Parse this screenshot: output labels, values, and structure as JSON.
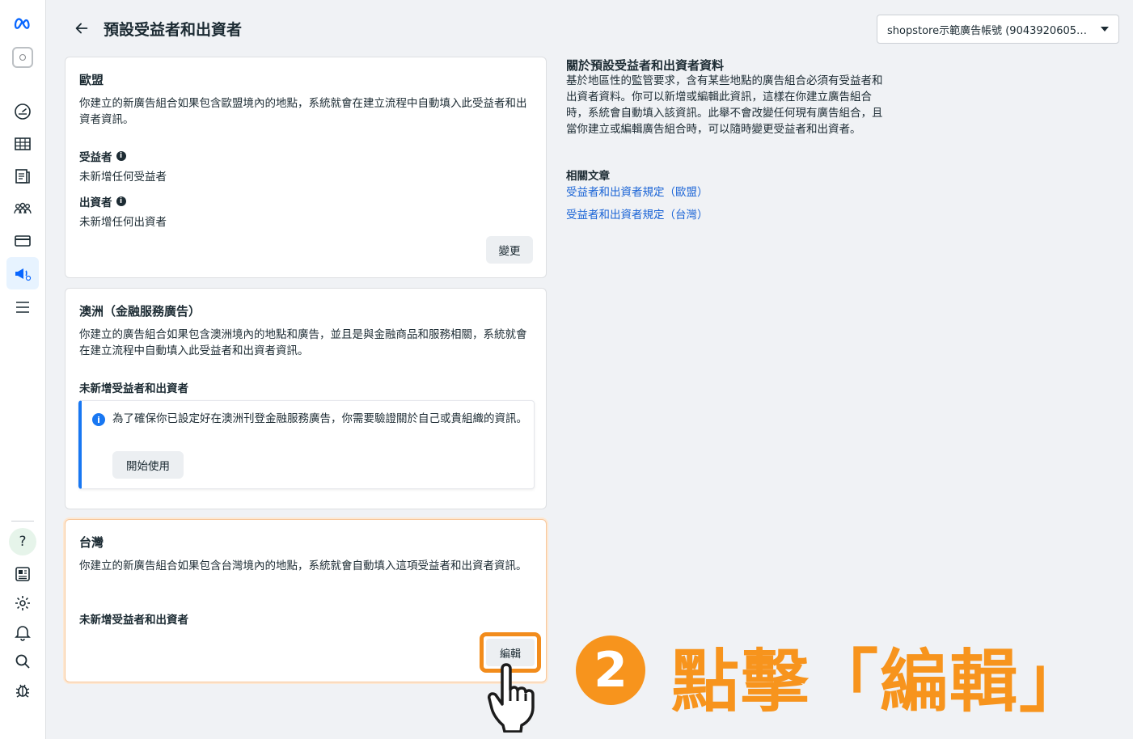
{
  "header": {
    "title": "預設受益者和出資者",
    "account_selector": "shopstore示範廣告帳號 (904392060586…"
  },
  "cards": {
    "eu": {
      "title": "歐盟",
      "description": "你建立的新廣告組合如果包含歐盟境內的地點，系統就會在建立流程中自動填入此受益者和出資者資訊。",
      "beneficiary_label": "受益者",
      "beneficiary_value": "未新增任何受益者",
      "payer_label": "出資者",
      "payer_value": "未新增任何出資者",
      "change_button": "變更"
    },
    "australia": {
      "title": "澳洲（金融服務廣告）",
      "description": "你建立的廣告組合如果包含澳洲境內的地點和廣告，並且是與金融商品和服務相關，系統就會在建立流程中自動填入此受益者和出資者資訊。",
      "status": "未新增受益者和出資者",
      "notice_text": "為了確保你已設定好在澳洲刊登金融服務廣告，你需要驗證關於自己或貴組織的資訊。",
      "start_button": "開始使用"
    },
    "taiwan": {
      "title": "台灣",
      "description": "你建立的新廣告組合如果包含台灣境內的地點，系統就會自動填入這項受益者和出資者資訊。",
      "status": "未新增受益者和出資者",
      "edit_button": "編輯"
    }
  },
  "info_panel": {
    "title": "關於預設受益者和出資者資料",
    "body": "基於地區性的監管要求，含有某些地點的廣告組合必須有受益者和出資者資料。你可以新增或編輯此資訊，這樣在你建立廣告組合時，系統會自動填入該資訊。此舉不會改變任何現有廣告組合，且當你建立或編輯廣告組合時，可以隨時變更受益者和出資者。",
    "related_title": "相關文章",
    "links": [
      "受益者和出資者規定（歐盟）",
      "受益者和出資者規定（台灣）"
    ]
  },
  "annotation": {
    "step_number": "2",
    "text": "點擊「編輯」"
  },
  "colors": {
    "accent_orange": "#f7941d",
    "link_blue": "#1a64d6",
    "meta_blue": "#0866ff"
  }
}
